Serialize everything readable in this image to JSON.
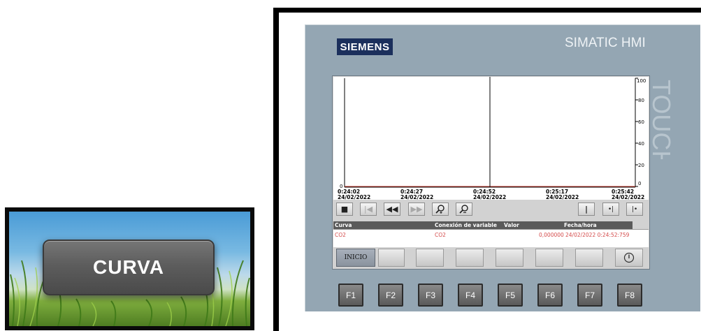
{
  "curva_button": {
    "label": "CURVA"
  },
  "hmi": {
    "brand": "SIEMENS",
    "model": "SIMATIC HMI",
    "side_label": "TOUCH"
  },
  "trend": {
    "right_axis_ticks": [
      "100",
      "80",
      "60",
      "40",
      "20",
      "0"
    ],
    "left_axis_label": "0",
    "time_labels": [
      {
        "time": "0:24:02",
        "date": "24/02/2022"
      },
      {
        "time": "0:24:27",
        "date": "24/02/2022"
      },
      {
        "time": "0:24:52",
        "date": "24/02/2022"
      },
      {
        "time": "0:25:17",
        "date": "24/02/2022"
      },
      {
        "time": "0:25:42",
        "date": "24/02/2022"
      }
    ]
  },
  "toolbar": {
    "buttons": [
      "stop-icon",
      "first-icon",
      "rewind-icon",
      "forward-icon",
      "zoom-in-icon",
      "zoom-out-icon",
      "ruler-icon",
      "ruler-back-icon",
      "ruler-forward-icon"
    ]
  },
  "table": {
    "headers": {
      "curve": "Curva",
      "connection": "Conexión de variable",
      "value": "Valor",
      "datetime": "Fecha/hora"
    },
    "row": {
      "curve": "CO2",
      "connection": "CO2",
      "value": "0,000000",
      "datetime": "24/02/2022 0:24:52:759"
    }
  },
  "screen_buttons": {
    "inicio": "INICIO"
  },
  "fkeys": [
    "F1",
    "F2",
    "F3",
    "F4",
    "F5",
    "F6",
    "F7",
    "F8"
  ]
}
